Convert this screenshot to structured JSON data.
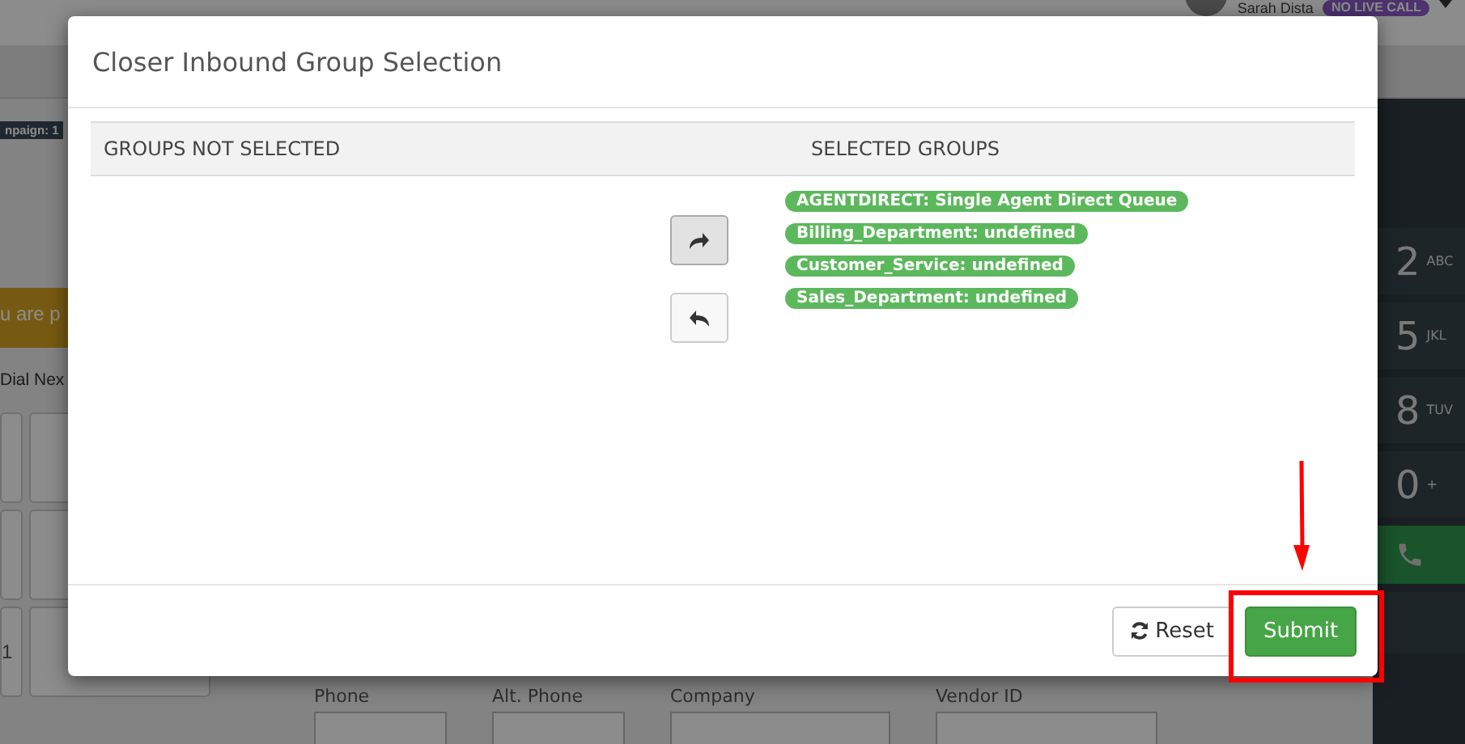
{
  "header": {
    "user_name": "Sarah Dista",
    "status_badge": "NO LIVE CALL"
  },
  "sidebar": {
    "campaign_tag": "npaign: 1",
    "alert": "u are p",
    "dial_next": "Dial Nex",
    "grid_key": "1"
  },
  "form": {
    "fields": [
      {
        "label": "Phone"
      },
      {
        "label": "Alt. Phone"
      },
      {
        "label": "Company"
      },
      {
        "label": "Vendor ID"
      }
    ]
  },
  "dialpad": {
    "keys": [
      {
        "digit": "2",
        "letters": "ABC"
      },
      {
        "digit": "5",
        "letters": "JKL"
      },
      {
        "digit": "8",
        "letters": "TUV"
      },
      {
        "digit": "0",
        "letters": "+"
      }
    ]
  },
  "modal": {
    "title": "Closer Inbound Group Selection",
    "columns": [
      "GROUPS NOT SELECTED",
      "SELECTED GROUPS"
    ],
    "move_buttons": [
      {
        "kind": "add",
        "selected": true
      },
      {
        "kind": "remove",
        "selected": false
      }
    ],
    "selected_groups": [
      "AGENTDIRECT: Single Agent Direct Queue",
      "Billing_Department: undefined",
      "Customer_Service: undefined",
      "Sales_Department: undefined"
    ],
    "buttons": [
      {
        "kind": "reset",
        "label": "Reset"
      },
      {
        "kind": "submit",
        "label": "Submit"
      }
    ]
  }
}
